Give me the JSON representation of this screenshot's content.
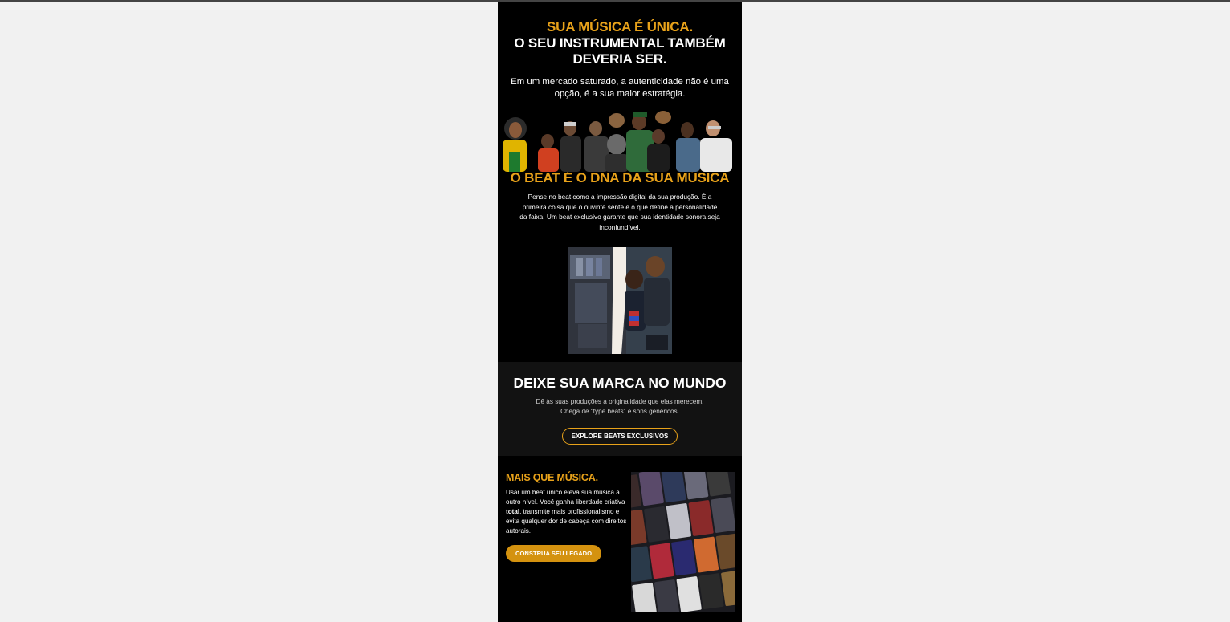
{
  "hero": {
    "title_line1": "SUA MÚSICA É ÚNICA.",
    "title_line2": "O SEU INSTRUMENTAL TAMBÉM DEVERIA SER.",
    "subtitle": "Em um mercado saturado, a autenticidade não é uma opção, é a sua maior estratégia."
  },
  "dna": {
    "title": "O BEAT É O DNA DA SUA MÚSICA",
    "body": "Pense no beat como a impressão digital da sua produção. É a primeira coisa que o ouvinte sente e o que define a personalidade da faixa. Um beat exclusivo garante que sua identidade sonora seja inconfundível."
  },
  "mark": {
    "title": "DEIXE SUA MARCA NO MUNDO",
    "body_line1": "Dê às suas produções a originalidade que elas merecem.",
    "body_line2": "Chega de \"type beats\" e sons genéricos.",
    "button_label": "EXPLORE BEATS EXCLUSIVOS"
  },
  "legacy": {
    "title": "MAIS QUE MÚSICA.",
    "body_part1": "Usar um beat único eleva sua música a outro nível. Você ganha liberdade criativa ",
    "body_bold": "total",
    "body_part2": ", transmite mais profissionalismo e evita qualquer dor de cabeça com direitos autorais.",
    "button_label": "CONSTRUA SEU LEGADO"
  },
  "colors": {
    "accent": "#e8a21a",
    "background": "#000000",
    "page_background": "#f1f1f1"
  }
}
